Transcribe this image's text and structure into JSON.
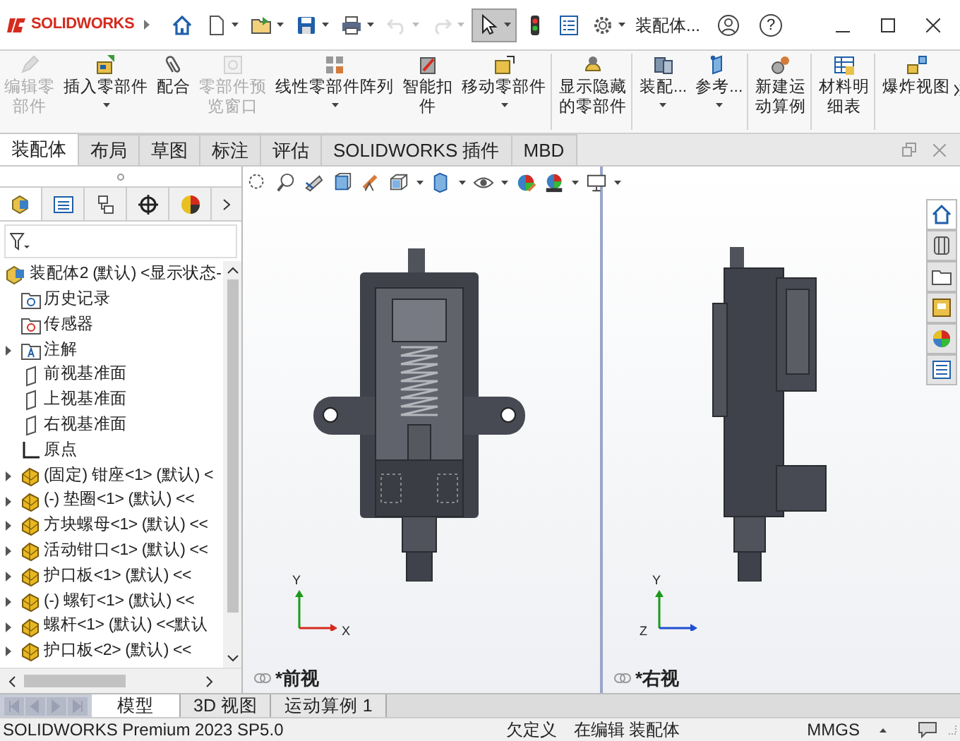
{
  "app": {
    "logo": "SOLIDWORKS"
  },
  "title_bar": {
    "document_title": "装配体...",
    "help": "?",
    "tools": [
      {
        "kind": "home",
        "disabled": false,
        "dropdown": false,
        "selected": false
      },
      {
        "kind": "new",
        "disabled": false,
        "dropdown": true,
        "selected": false
      },
      {
        "kind": "open",
        "disabled": false,
        "dropdown": true,
        "selected": false
      },
      {
        "kind": "save",
        "disabled": false,
        "dropdown": true,
        "selected": false
      },
      {
        "kind": "print",
        "disabled": false,
        "dropdown": true,
        "selected": false
      },
      {
        "kind": "undo",
        "disabled": true,
        "dropdown": true,
        "selected": false
      },
      {
        "kind": "redo",
        "disabled": true,
        "dropdown": true,
        "selected": false
      },
      {
        "kind": "select",
        "disabled": false,
        "dropdown": true,
        "selected": true
      },
      {
        "kind": "rebuild",
        "disabled": false,
        "dropdown": false,
        "selected": false
      },
      {
        "kind": "options",
        "disabled": false,
        "dropdown": false,
        "selected": false
      },
      {
        "kind": "settings",
        "disabled": false,
        "dropdown": true,
        "selected": false
      }
    ]
  },
  "ribbon": [
    {
      "lines": [
        "编辑零",
        "部件"
      ],
      "disabled": true,
      "dropdown": false,
      "separator_before": false
    },
    {
      "lines": [
        "插入零部件"
      ],
      "disabled": false,
      "dropdown": true,
      "separator_before": false
    },
    {
      "lines": [
        "配合"
      ],
      "disabled": false,
      "dropdown": false,
      "separator_before": false
    },
    {
      "lines": [
        "零部件预",
        "览窗口"
      ],
      "disabled": true,
      "dropdown": false,
      "separator_before": false
    },
    {
      "lines": [
        "线性零部件阵列"
      ],
      "disabled": false,
      "dropdown": true,
      "separator_before": false
    },
    {
      "lines": [
        "智能扣",
        "件"
      ],
      "disabled": false,
      "dropdown": false,
      "separator_before": false
    },
    {
      "lines": [
        "移动零部件"
      ],
      "disabled": false,
      "dropdown": true,
      "separator_before": false
    },
    {
      "lines": [
        "显示隐藏",
        "的零部件"
      ],
      "disabled": false,
      "dropdown": false,
      "separator_before": true
    },
    {
      "lines": [
        "装配..."
      ],
      "disabled": false,
      "dropdown": true,
      "separator_before": true
    },
    {
      "lines": [
        "参考..."
      ],
      "disabled": false,
      "dropdown": true,
      "separator_before": false
    },
    {
      "lines": [
        "新建运",
        "动算例"
      ],
      "disabled": false,
      "dropdown": false,
      "separator_before": true
    },
    {
      "lines": [
        "材料明",
        "细表"
      ],
      "disabled": false,
      "dropdown": false,
      "separator_before": true
    },
    {
      "lines": [
        "爆炸视图"
      ],
      "disabled": false,
      "dropdown": false,
      "separator_before": true
    }
  ],
  "tabs": [
    {
      "label": "装配体",
      "selected": true
    },
    {
      "label": "布局",
      "selected": false
    },
    {
      "label": "草图",
      "selected": false
    },
    {
      "label": "标注",
      "selected": false
    },
    {
      "label": "评估",
      "selected": false
    },
    {
      "label": "SOLIDWORKS 插件",
      "selected": false
    },
    {
      "label": "MBD",
      "selected": false
    }
  ],
  "panel_tabs": [
    {
      "kind": "feature",
      "selected": true
    },
    {
      "kind": "property",
      "selected": false
    },
    {
      "kind": "config",
      "selected": false
    },
    {
      "kind": "dim",
      "selected": false
    },
    {
      "kind": "display",
      "selected": false
    }
  ],
  "tree": [
    {
      "kind": "assembly",
      "label": "装配体2 (默认) <显示状态-",
      "children": [
        {
          "kind": "history",
          "label": "历史记录"
        },
        {
          "kind": "sensor",
          "label": "传感器"
        },
        {
          "kind": "annotation",
          "label": "注解",
          "expanded": false
        },
        {
          "kind": "plane",
          "label": "前视基准面"
        },
        {
          "kind": "plane",
          "label": "上视基准面"
        },
        {
          "kind": "plane",
          "label": "右视基准面"
        },
        {
          "kind": "origin",
          "label": "原点"
        },
        {
          "kind": "component",
          "label": "(固定) 钳座<1> (默认) <",
          "expanded": false
        },
        {
          "kind": "component",
          "label": "(-) 垫圈<1> (默认) <<",
          "expanded": false
        },
        {
          "kind": "component",
          "label": "方块螺母<1> (默认) <<",
          "expanded": false
        },
        {
          "kind": "component",
          "label": "活动钳口<1> (默认) <<",
          "expanded": false
        },
        {
          "kind": "component",
          "label": "护口板<1> (默认) <<",
          "expanded": false
        },
        {
          "kind": "component",
          "label": "(-) 螺钉<1> (默认) <<",
          "expanded": false
        },
        {
          "kind": "component",
          "label": "螺杆<1> (默认) <<默认",
          "expanded": false
        },
        {
          "kind": "component",
          "label": "护口板<2> (默认) <<",
          "expanded": false
        }
      ]
    }
  ],
  "task_pane_tabs": [
    {
      "kind": "home",
      "selected": true
    },
    {
      "kind": "library",
      "selected": false
    },
    {
      "kind": "explorer",
      "selected": false
    },
    {
      "kind": "palette",
      "selected": false
    },
    {
      "kind": "appearance",
      "selected": false
    },
    {
      "kind": "properties",
      "selected": false
    }
  ],
  "views": [
    {
      "label": "*前视",
      "kind": "front",
      "axes": [
        "Y",
        "X"
      ]
    },
    {
      "label": "*右视",
      "kind": "right",
      "axes": [
        "Y",
        "Z"
      ]
    }
  ],
  "bottom_tabs": [
    {
      "label": "模型",
      "selected": true
    },
    {
      "label": "3D 视图",
      "selected": false
    },
    {
      "label": "运动算例 1",
      "selected": false
    }
  ],
  "status_bar": {
    "product": "SOLIDWORKS Premium 2023 SP5.0",
    "state": "欠定义",
    "mode": "在编辑 装配体",
    "units": "MMGS"
  }
}
